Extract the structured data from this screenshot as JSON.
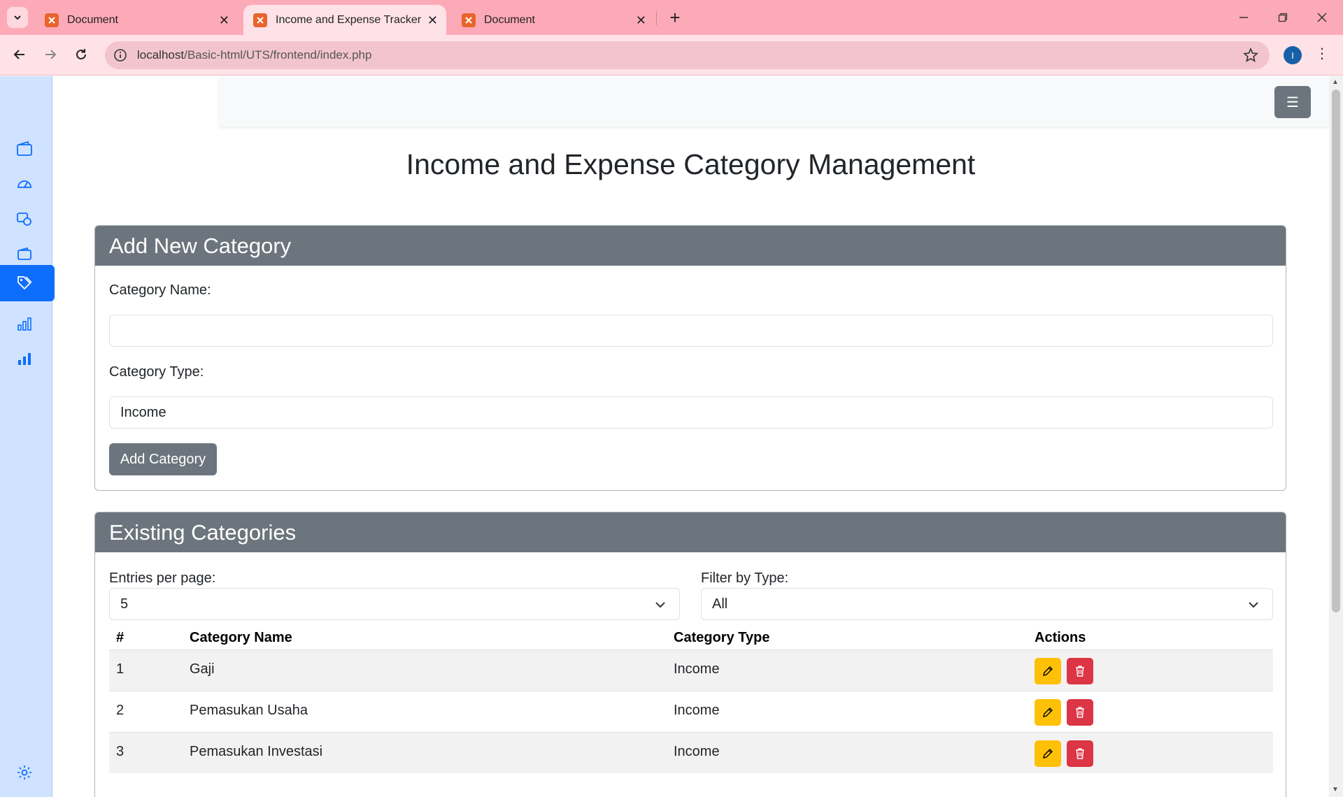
{
  "browser": {
    "tabs": [
      {
        "title": "Document",
        "active": false
      },
      {
        "title": "Income and Expense Tracker",
        "active": true
      },
      {
        "title": "Document",
        "active": false
      }
    ],
    "url_host": "localhost",
    "url_path": "/Basic-html/UTS/frontend/index.php",
    "profile_initial": "I"
  },
  "sidebar": {
    "items": [
      {
        "icon": "wallet-icon",
        "active": false
      },
      {
        "icon": "dashboard-icon",
        "active": false
      },
      {
        "icon": "transactions-icon",
        "active": false
      },
      {
        "icon": "accounts-icon",
        "active": false
      },
      {
        "icon": "tags-icon",
        "active": true
      },
      {
        "icon": "bar-chart-icon",
        "active": false
      },
      {
        "icon": "bar-chart-filled-icon",
        "active": false
      }
    ],
    "footer_icon": "gear-icon",
    "active_color": "#0d6efd"
  },
  "page": {
    "title": "Income and Expense Category Management"
  },
  "add_card": {
    "header": "Add New Category",
    "name_label": "Category Name:",
    "name_value": "",
    "type_label": "Category Type:",
    "type_value": "Income",
    "submit_label": "Add Category"
  },
  "list_card": {
    "header": "Existing Categories",
    "entries_label": "Entries per page:",
    "entries_value": "5",
    "filter_label": "Filter by Type:",
    "filter_value": "All",
    "columns": {
      "num": "#",
      "name": "Category Name",
      "type": "Category Type",
      "actions": "Actions"
    },
    "rows": [
      {
        "num": "1",
        "name": "Gaji",
        "type": "Income"
      },
      {
        "num": "2",
        "name": "Pemasukan Usaha",
        "type": "Income"
      },
      {
        "num": "3",
        "name": "Pemasukan Investasi",
        "type": "Income"
      }
    ]
  },
  "colors": {
    "header_gray": "#6c757d",
    "edit_button": "#ffc107",
    "delete_button": "#dc3545",
    "tab_bar": "#fdaab8"
  }
}
